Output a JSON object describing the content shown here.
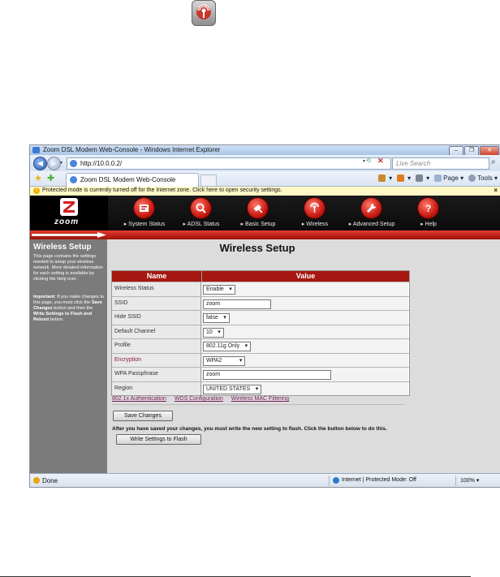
{
  "window": {
    "title": "Zoom DSL Modem Web-Console - Windows Internet Explorer",
    "buttons": [
      "–",
      "❐",
      "✕"
    ]
  },
  "addressbar": {
    "url": "http://10.0.0.2/",
    "search_placeholder": "Live Search"
  },
  "tabbar": {
    "tab_label": "Zoom DSL Modem Web-Console",
    "commands": [
      "",
      "",
      "",
      "Page ▾",
      "Tools ▾"
    ]
  },
  "infobar": {
    "message": "Protected mode is currently turned off for the Internet zone. Click here to open security settings."
  },
  "menu": {
    "items": [
      "▸ System Status",
      "▸ ADSL Status",
      "▸ Basic Setup",
      "▸ Wireless",
      "▸ Advanced Setup",
      "▸ Help"
    ]
  },
  "logo": {
    "text": "zoom"
  },
  "sidebar": {
    "title": "Wireless Setup",
    "body": "This page contains the settings needed to setup your wireless network. More detailed information for each setting is available by clicking the Help icon.",
    "important_label": "Important:",
    "important_text1": " If you make changes to this page, you must click the ",
    "save_changes": "Save Changes",
    "important_text2": " button and then the ",
    "write_settings": "Write Settings to Flash and Reboot",
    "important_text3": " button."
  },
  "page": {
    "title": "Wireless Setup",
    "col_name": "Name",
    "col_value": "Value",
    "rows": [
      {
        "name": "Wireless Status",
        "value": "Enable"
      },
      {
        "name": "SSID",
        "value": "zoom"
      },
      {
        "name": "Hide SSID",
        "value": "false"
      },
      {
        "name": "Default Channel",
        "value": "10"
      },
      {
        "name": "Profile",
        "value": "802.11g Only"
      },
      {
        "name": "Encryption",
        "value": "WPA2"
      },
      {
        "name": "WPA Passphrase",
        "value": "zoom"
      },
      {
        "name": "Region",
        "value": "UNITED STATES"
      }
    ],
    "links": [
      "802.1x Authentication",
      "WDS Configuration",
      "Wireless MAC Filtering"
    ],
    "save_button": "Save Changes",
    "note": "After you have saved your changes, you must write the new setting to flash. Click the button below to do this.",
    "write_button": "Write Settings to Flash"
  },
  "statusbar": {
    "status": "Done",
    "zone": "Internet | Protected Mode: Off",
    "zoom": "100%  ▾"
  }
}
